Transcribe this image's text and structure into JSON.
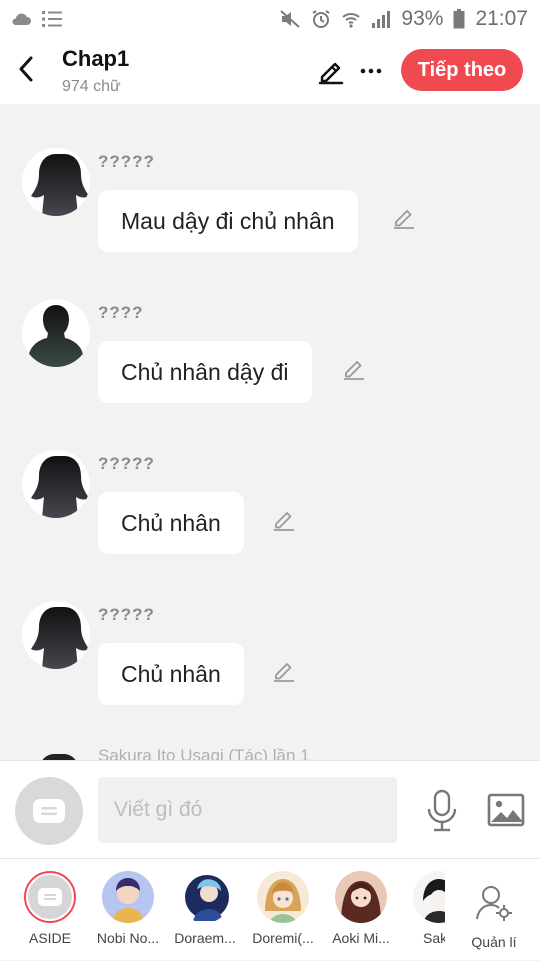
{
  "status_bar": {
    "battery": "93%",
    "time": "21:07"
  },
  "header": {
    "title": "Chap1",
    "word_count": "974 chữ",
    "next_label": "Tiếp theo",
    "next_color": "#f04a50"
  },
  "messages": [
    {
      "speaker": "?????",
      "text": "Mau dậy đi chủ nhân",
      "avatar": "female-silhouette"
    },
    {
      "speaker": "????",
      "text": "Chủ nhân dậy đi",
      "avatar": "male-silhouette"
    },
    {
      "speaker": "?????",
      "text": "Chủ nhân",
      "avatar": "female-silhouette"
    },
    {
      "speaker": "?????",
      "text": "Chủ nhân",
      "avatar": "female-silhouette"
    }
  ],
  "partial_message": {
    "speaker_fragment": "Sakura Ito Usagi (Tác) lần 1"
  },
  "composer": {
    "placeholder": "Viết gì đó"
  },
  "characters": [
    {
      "name": "ASIDE",
      "selected": true
    },
    {
      "name": "Nobi No..."
    },
    {
      "name": "Doraem..."
    },
    {
      "name": "Doremi(..."
    },
    {
      "name": "Aoki Mi..."
    },
    {
      "name": "Saka"
    }
  ],
  "manage_label": "Quản lí"
}
